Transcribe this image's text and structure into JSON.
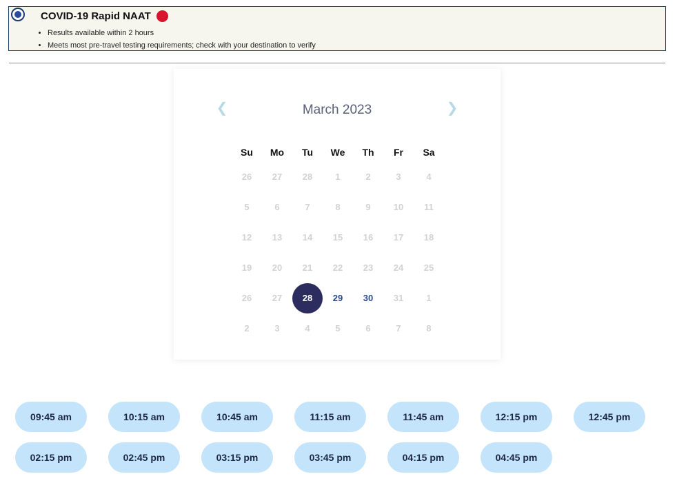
{
  "test_option": {
    "title": "COVID-19 Rapid NAAT",
    "status_color": "#d7132e",
    "bullets": [
      "Results available within 2 hours",
      "Meets most pre-travel testing requirements; check with your destination to verify"
    ]
  },
  "calendar": {
    "month_label": "March 2023",
    "prev_icon": "chevron-left-icon",
    "next_icon": "chevron-right-icon",
    "weekdays": [
      "Su",
      "Mo",
      "Tu",
      "We",
      "Th",
      "Fr",
      "Sa"
    ],
    "weeks": [
      [
        {
          "d": "26",
          "s": "disabled"
        },
        {
          "d": "27",
          "s": "disabled"
        },
        {
          "d": "28",
          "s": "disabled"
        },
        {
          "d": "1",
          "s": "disabled"
        },
        {
          "d": "2",
          "s": "disabled"
        },
        {
          "d": "3",
          "s": "disabled"
        },
        {
          "d": "4",
          "s": "disabled"
        }
      ],
      [
        {
          "d": "5",
          "s": "disabled"
        },
        {
          "d": "6",
          "s": "disabled"
        },
        {
          "d": "7",
          "s": "disabled"
        },
        {
          "d": "8",
          "s": "disabled"
        },
        {
          "d": "9",
          "s": "disabled"
        },
        {
          "d": "10",
          "s": "disabled"
        },
        {
          "d": "11",
          "s": "disabled"
        }
      ],
      [
        {
          "d": "12",
          "s": "disabled"
        },
        {
          "d": "13",
          "s": "disabled"
        },
        {
          "d": "14",
          "s": "disabled"
        },
        {
          "d": "15",
          "s": "disabled"
        },
        {
          "d": "16",
          "s": "disabled"
        },
        {
          "d": "17",
          "s": "disabled"
        },
        {
          "d": "18",
          "s": "disabled"
        }
      ],
      [
        {
          "d": "19",
          "s": "disabled"
        },
        {
          "d": "20",
          "s": "disabled"
        },
        {
          "d": "21",
          "s": "disabled"
        },
        {
          "d": "22",
          "s": "disabled"
        },
        {
          "d": "23",
          "s": "disabled"
        },
        {
          "d": "24",
          "s": "disabled"
        },
        {
          "d": "25",
          "s": "disabled"
        }
      ],
      [
        {
          "d": "26",
          "s": "disabled"
        },
        {
          "d": "27",
          "s": "disabled"
        },
        {
          "d": "28",
          "s": "selected"
        },
        {
          "d": "29",
          "s": "available"
        },
        {
          "d": "30",
          "s": "available"
        },
        {
          "d": "31",
          "s": "disabled"
        },
        {
          "d": "1",
          "s": "disabled"
        }
      ],
      [
        {
          "d": "2",
          "s": "disabled"
        },
        {
          "d": "3",
          "s": "disabled"
        },
        {
          "d": "4",
          "s": "disabled"
        },
        {
          "d": "5",
          "s": "disabled"
        },
        {
          "d": "6",
          "s": "disabled"
        },
        {
          "d": "7",
          "s": "disabled"
        },
        {
          "d": "8",
          "s": "disabled"
        }
      ]
    ]
  },
  "time_slots": [
    "09:45 am",
    "10:15 am",
    "10:45 am",
    "11:15 am",
    "11:45 am",
    "12:15 pm",
    "12:45 pm",
    "02:15 pm",
    "02:45 pm",
    "03:15 pm",
    "03:45 pm",
    "04:15 pm",
    "04:45 pm"
  ]
}
